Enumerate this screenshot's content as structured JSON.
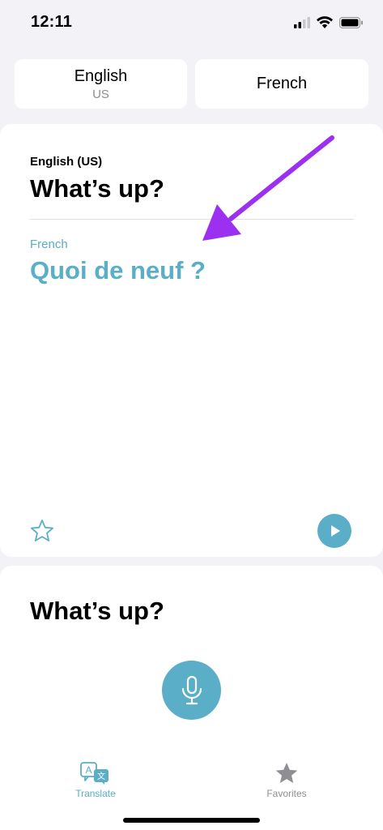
{
  "status_bar": {
    "time": "12:11",
    "icons": [
      "cellular-signal-icon",
      "wifi-icon",
      "battery-icon"
    ]
  },
  "language_picker": {
    "source": {
      "name": "English",
      "region": "US"
    },
    "target": {
      "name": "French"
    }
  },
  "translation_card": {
    "source_language_label": "English (US)",
    "source_text": "What’s up?",
    "target_language_label": "French",
    "target_text": "Quoi de neuf ?",
    "favorite_icon": "star-outline-icon",
    "play_icon": "play-icon"
  },
  "input_card": {
    "text": "What’s up?",
    "mic_icon": "microphone-icon"
  },
  "tab_bar": {
    "tabs": [
      {
        "label": "Translate",
        "icon": "translate-icon",
        "active": true
      },
      {
        "label": "Favorites",
        "icon": "star-filled-icon",
        "active": false
      }
    ]
  },
  "colors": {
    "accent": "#5aaec7",
    "background": "#f2f2f7",
    "annotation_arrow": "#9b30f0",
    "inactive": "#8e8e93"
  }
}
